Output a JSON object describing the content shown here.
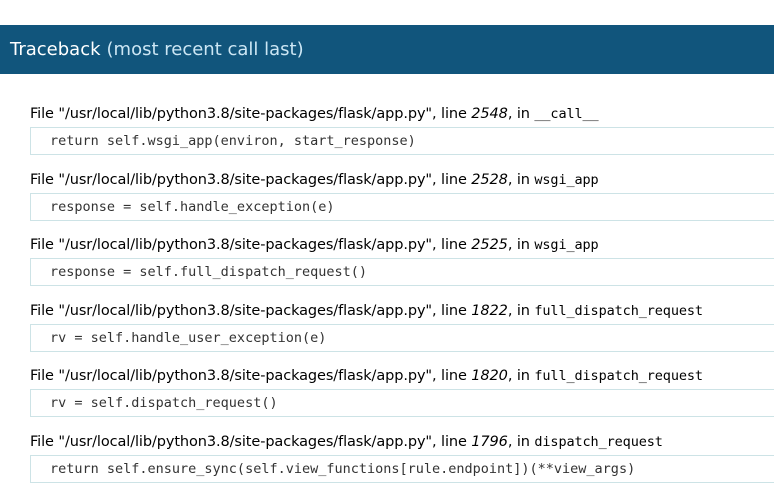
{
  "header": {
    "title": "Traceback",
    "subtitle": "(most recent call last)",
    "background_color": "#11557c"
  },
  "frames": [
    {
      "file_prefix": "File ",
      "filename": "\"/usr/local/lib/python3.8/site-packages/flask/app.py\"",
      "line_label": ", line ",
      "lineno": "2548",
      "in_label": ", in ",
      "function": "__call__",
      "code": "return self.wsgi_app(environ, start_response)"
    },
    {
      "file_prefix": "File ",
      "filename": "\"/usr/local/lib/python3.8/site-packages/flask/app.py\"",
      "line_label": ", line ",
      "lineno": "2528",
      "in_label": ", in ",
      "function": "wsgi_app",
      "code": "response = self.handle_exception(e)"
    },
    {
      "file_prefix": "File ",
      "filename": "\"/usr/local/lib/python3.8/site-packages/flask/app.py\"",
      "line_label": ", line ",
      "lineno": "2525",
      "in_label": ", in ",
      "function": "wsgi_app",
      "code": "response = self.full_dispatch_request()"
    },
    {
      "file_prefix": "File ",
      "filename": "\"/usr/local/lib/python3.8/site-packages/flask/app.py\"",
      "line_label": ", line ",
      "lineno": "1822",
      "in_label": ", in ",
      "function": "full_dispatch_request",
      "code": "rv = self.handle_user_exception(e)"
    },
    {
      "file_prefix": "File ",
      "filename": "\"/usr/local/lib/python3.8/site-packages/flask/app.py\"",
      "line_label": ", line ",
      "lineno": "1820",
      "in_label": ", in ",
      "function": "full_dispatch_request",
      "code": "rv = self.dispatch_request()"
    },
    {
      "file_prefix": "File ",
      "filename": "\"/usr/local/lib/python3.8/site-packages/flask/app.py\"",
      "line_label": ", line ",
      "lineno": "1796",
      "in_label": ", in ",
      "function": "dispatch_request",
      "code": "return self.ensure_sync(self.view_functions[rule.endpoint])(**view_args)"
    }
  ]
}
